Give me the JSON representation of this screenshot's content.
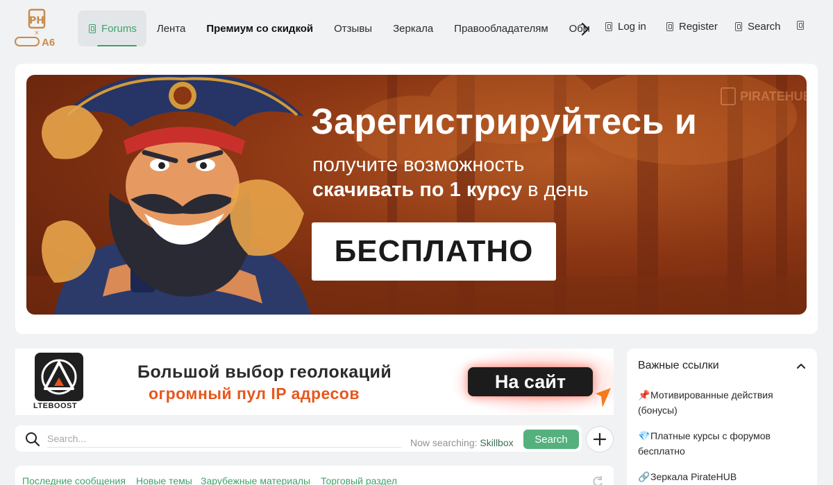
{
  "header": {
    "logo_text": "A6",
    "nav": [
      {
        "label": "Forums",
        "active": true
      },
      {
        "label": "Лента"
      },
      {
        "label": "Премиум со скидкой",
        "bold": true
      },
      {
        "label": "Отзывы"
      },
      {
        "label": "Зеркала"
      },
      {
        "label": "Правообладателям"
      },
      {
        "label": "Обм"
      }
    ],
    "login_label": "Log in",
    "register_label": "Register",
    "search_label": "Search"
  },
  "banner": {
    "title": "Зарегистрируйтесь и",
    "line1": "получите возможность",
    "line2_bold": "скачивать по 1 курсу",
    "line2_rest": " в день",
    "button": "БЕСПЛАТНО",
    "brand": "PIRATEHUB"
  },
  "ad": {
    "logo_text": "LTEBOOST",
    "line1": "Большой выбор геолокаций",
    "line2": "огромный пул IP адресов",
    "button": "На сайт"
  },
  "search": {
    "placeholder": "Search...",
    "now_label": "Now searching:",
    "now_value": "Skillbox",
    "button": "Search"
  },
  "tabs": [
    "Последние сообщения",
    "Новые темы",
    "Зарубежные материалы",
    "Торговый раздел"
  ],
  "sidebar": {
    "title": "Важные ссылки",
    "links": [
      {
        "icon": "📌",
        "label": "Мотивированные действия (бонусы)"
      },
      {
        "icon": "💎",
        "label": "Платные курсы с форумов бесплатно"
      },
      {
        "icon": "🔗",
        "label": "Зеркала PirateHUB"
      }
    ]
  },
  "colors": {
    "accent": "#3ea26a",
    "search_button": "#54b07c",
    "ad_orange": "#e8561c"
  }
}
